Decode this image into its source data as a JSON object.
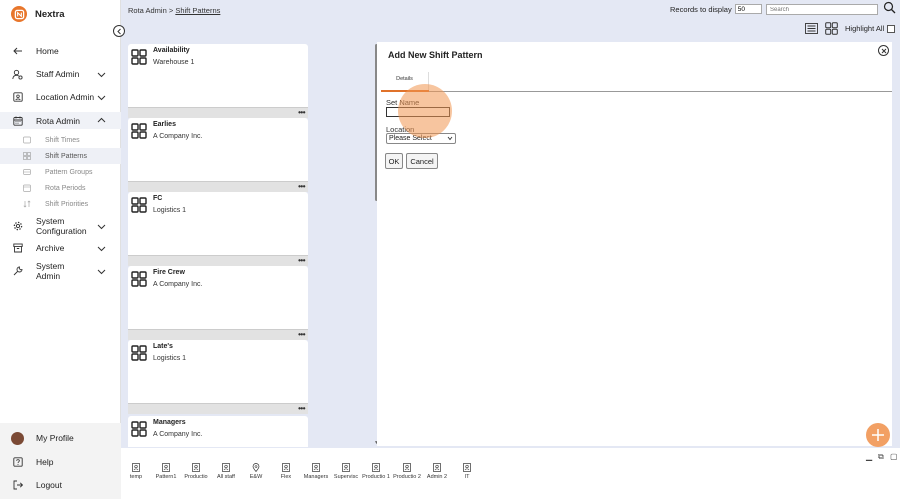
{
  "app": {
    "name": "Nextra",
    "accent": "#e8762b"
  },
  "sidebar": {
    "items": [
      {
        "label": "Home",
        "icon": "arrow-left-icon"
      },
      {
        "label": "Staff Admin",
        "icon": "user-settings-icon"
      },
      {
        "label": "Location Admin",
        "icon": "location-card-icon"
      },
      {
        "label": "Rota Admin",
        "icon": "calendar-icon"
      },
      {
        "label": "System Configuration",
        "icon": "gear-icon"
      },
      {
        "label": "Archive",
        "icon": "archive-icon"
      },
      {
        "label": "System Admin",
        "icon": "wrench-icon"
      }
    ],
    "sub_items": [
      {
        "label": "Shift Times"
      },
      {
        "label": "Shift Patterns"
      },
      {
        "label": "Pattern Groups"
      },
      {
        "label": "Rota Periods"
      },
      {
        "label": "Shift Priorities"
      }
    ],
    "bottom": [
      {
        "label": "My Profile"
      },
      {
        "label": "Help"
      },
      {
        "label": "Logout"
      }
    ]
  },
  "header": {
    "breadcrumb_root": "Rota Admin",
    "breadcrumb_sep": " > ",
    "breadcrumb_current": "Shift Patterns",
    "records_label": "Records to display",
    "records_value": "50",
    "search_placeholder": "Search",
    "highlight_label": "Highlight All"
  },
  "patterns": [
    {
      "name": "Availability",
      "org": "Warehouse 1"
    },
    {
      "name": "Earlies",
      "org": "A Company Inc."
    },
    {
      "name": "FC",
      "org": "Logistics 1"
    },
    {
      "name": "Fire Crew",
      "org": "A Company Inc."
    },
    {
      "name": "Late's",
      "org": "Logistics 1"
    },
    {
      "name": "Managers",
      "org": "A Company Inc."
    }
  ],
  "panel": {
    "title": "Add New Shift Pattern",
    "tab": "Details",
    "set_name_label": "Set Name",
    "set_name_value": "",
    "location_label": "Location",
    "location_value": "Please Select",
    "ok_label": "OK",
    "cancel_label": "Cancel"
  },
  "tray": [
    {
      "label": "temp"
    },
    {
      "label": "Pattern1"
    },
    {
      "label": "Productio"
    },
    {
      "label": "All staff"
    },
    {
      "label": "E&W"
    },
    {
      "label": "Flex"
    },
    {
      "label": "Managers"
    },
    {
      "label": "Supervisc"
    },
    {
      "label": "Productio 1"
    },
    {
      "label": "Productio 2"
    },
    {
      "label": "Admin 2"
    },
    {
      "label": "IT"
    }
  ]
}
